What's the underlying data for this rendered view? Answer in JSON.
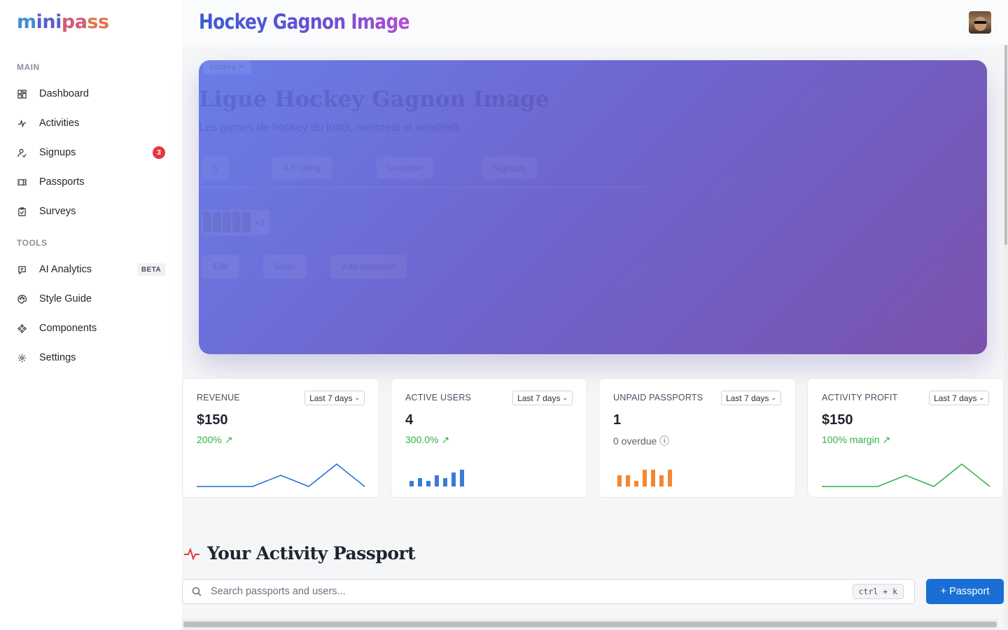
{
  "app": {
    "logo_text": "minipass",
    "org_title": "Hockey Gagnon Image"
  },
  "sidebar": {
    "sections": [
      {
        "label": "MAIN"
      },
      {
        "label": "TOOLS"
      }
    ],
    "items": [
      {
        "label": "Dashboard",
        "icon": "dashboard-icon"
      },
      {
        "label": "Activities",
        "icon": "activity-icon"
      },
      {
        "label": "Signups",
        "icon": "user-signup-icon",
        "badge": "3"
      },
      {
        "label": "Passports",
        "icon": "ticket-icon"
      },
      {
        "label": "Surveys",
        "icon": "clipboard-icon"
      },
      {
        "label": "AI Analytics",
        "icon": "chat-icon",
        "badge": "BETA"
      },
      {
        "label": "Style Guide",
        "icon": "palette-icon"
      },
      {
        "label": "Components",
        "icon": "components-icon"
      },
      {
        "label": "Settings",
        "icon": "gear-icon"
      }
    ]
  },
  "hero": {
    "tag": "Hockey ✕",
    "title": "Ligue Hockey Gagnon Image",
    "description": "Les games de hockey du lundi, mercredi et vendredi.",
    "stats": [
      "5",
      "4.8 rating",
      "Location",
      "Signups"
    ],
    "avatar_more": "+3",
    "buttons": [
      "Edit",
      "Scan",
      "Add passport"
    ],
    "gradient_colors": [
      "#6a7de8",
      "#7a52ad"
    ]
  },
  "kpis": [
    {
      "label": "REVENUE",
      "range": "Last 7 days",
      "value": "$150",
      "sub": "200%",
      "sub_style": "green",
      "chart": {
        "type": "line",
        "color": "#1a6fd6",
        "values": [
          0,
          0,
          0,
          1,
          0,
          2,
          0
        ]
      }
    },
    {
      "label": "ACTIVE USERS",
      "range": "Last 7 days",
      "value": "4",
      "sub": "300.0%",
      "sub_style": "green",
      "chart": {
        "type": "bar",
        "color": "#3a7bd5",
        "values": [
          2,
          3,
          2,
          4,
          3,
          5,
          6
        ]
      }
    },
    {
      "label": "UNPAID PASSPORTS",
      "range": "Last 7 days",
      "value": "1",
      "sub": "0 overdue",
      "sub_style": "gray",
      "chart": {
        "type": "bar",
        "color": "#f58632",
        "values": [
          2,
          2,
          1,
          3,
          3,
          2,
          3
        ]
      }
    },
    {
      "label": "ACTIVITY PROFIT",
      "range": "Last 7 days",
      "value": "$150",
      "sub": "100% margin",
      "sub_style": "green",
      "chart": {
        "type": "line",
        "color": "#2fb344",
        "values": [
          0,
          0,
          0,
          1,
          0,
          2,
          0
        ]
      }
    }
  ],
  "section": {
    "title": "Your Activity Passport",
    "search_placeholder": "Search passports and users...",
    "shortcut": "ctrl + k",
    "add_button": "+ Passport"
  }
}
